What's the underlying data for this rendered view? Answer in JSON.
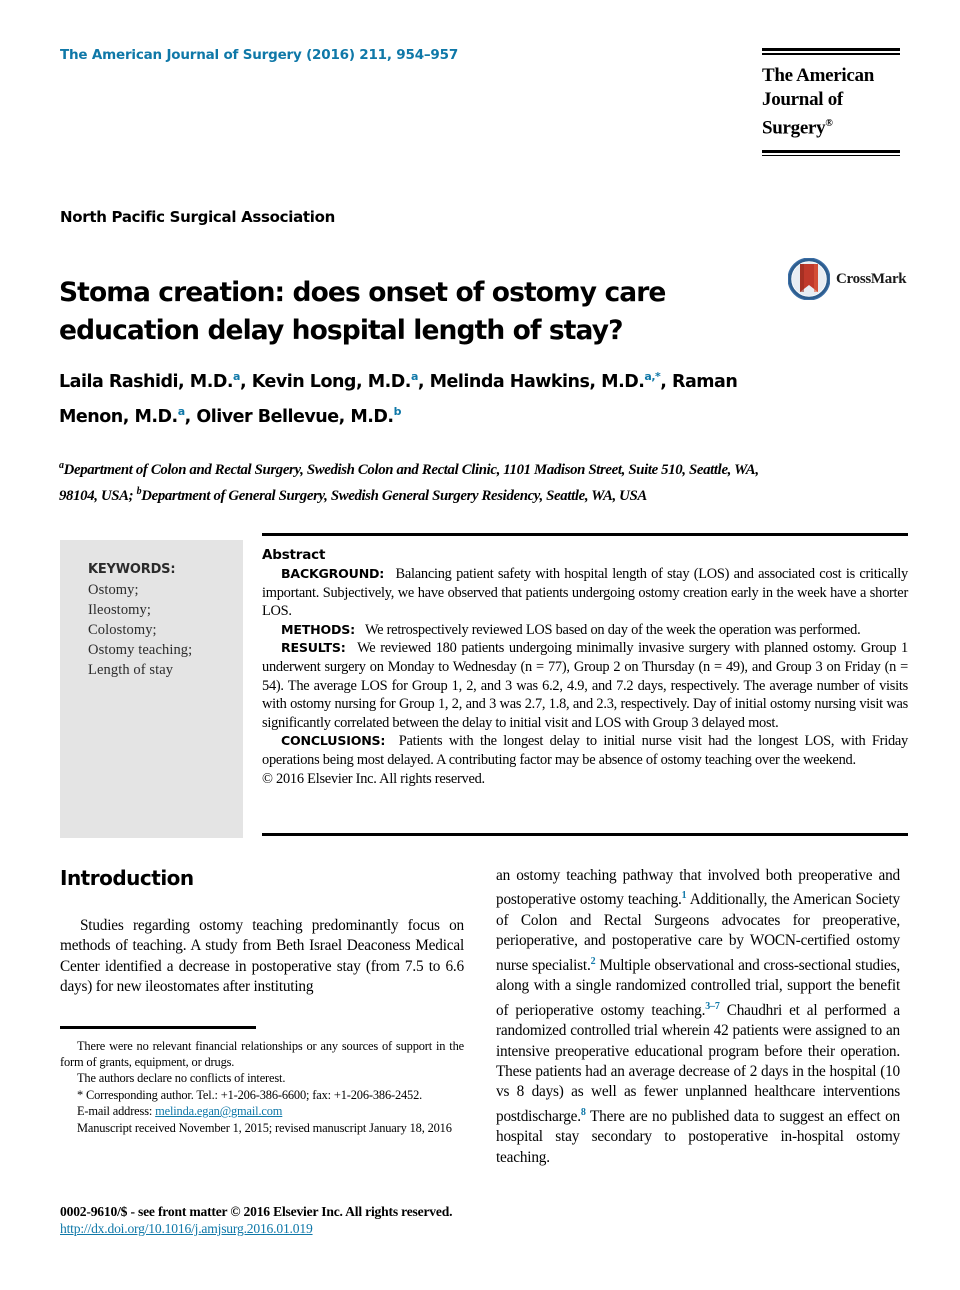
{
  "running_head": "The American Journal of Surgery (2016) 211, 954–957",
  "accent_color": "#0f78a8",
  "journal_logo": {
    "line1": "The American",
    "line2": "Journal of Surgery",
    "trademark": "®"
  },
  "society_line": "North Pacific Surgical Association",
  "article_title": "Stoma creation: does onset of ostomy care education delay hospital length of stay?",
  "crossmark": {
    "label": "CrossMark",
    "icon": "crossmark-badge-icon"
  },
  "authors": [
    {
      "name": "Laila Rashidi, M.D.",
      "marks": "a",
      "sep": ", "
    },
    {
      "name": "Kevin Long, M.D.",
      "marks": "a",
      "sep": ", "
    },
    {
      "name": "Melinda Hawkins, M.D.",
      "marks": "a,*",
      "sep": ", "
    },
    {
      "name": "Raman Menon, M.D.",
      "marks": "a",
      "sep": ", "
    },
    {
      "name": "Oliver Bellevue, M.D.",
      "marks": "b",
      "sep": ""
    }
  ],
  "affiliations": [
    {
      "mark": "a",
      "text": "Department of Colon and Rectal Surgery, Swedish Colon and Rectal Clinic, 1101 Madison Street, Suite 510, Seattle, WA, 98104, USA; "
    },
    {
      "mark": "b",
      "text": "Department of General Surgery, Swedish General Surgery Residency, Seattle, WA, USA"
    }
  ],
  "keywords": {
    "heading": "KEYWORDS:",
    "items": [
      "Ostomy;",
      "Ileostomy;",
      "Colostomy;",
      "Ostomy teaching;",
      "Length of stay"
    ]
  },
  "abstract": {
    "heading": "Abstract",
    "sections": [
      {
        "label": "BACKGROUND:",
        "text": "Balancing patient safety with hospital length of stay (LOS) and associated cost is critically important. Subjectively, we have observed that patients undergoing ostomy creation early in the week have a shorter LOS."
      },
      {
        "label": "METHODS:",
        "text": "We retrospectively reviewed LOS based on day of the week the operation was performed."
      },
      {
        "label": "RESULTS:",
        "text": "We reviewed 180 patients undergoing minimally invasive surgery with planned ostomy. Group 1 underwent surgery on Monday to Wednesday (n = 77), Group 2 on Thursday (n = 49), and Group 3 on Friday (n = 54). The average LOS for Group 1, 2, and 3 was 6.2, 4.9, and 7.2 days, respectively. The average number of visits with ostomy nursing for Group 1, 2, and 3 was 2.7, 1.8, and 2.3, respectively. Day of initial ostomy nursing visit was significantly correlated between the delay to initial visit and LOS with Group 3 delayed most."
      },
      {
        "label": "CONCLUSIONS:",
        "text": "Patients with the longest delay to initial nurse visit had the longest LOS, with Friday operations being most delayed. A contributing factor may be absence of ostomy teaching over the weekend."
      }
    ],
    "copyright": "© 2016 Elsevier Inc. All rights reserved."
  },
  "introduction": {
    "heading": "Introduction",
    "left_paragraph_part1": "Studies regarding ostomy teaching predominantly focus on methods of teaching. A study from Beth Israel Deaconess Medical Center identified a decrease in postoperative stay (from 7.5 to 6.6 days) for new ileostomates after instituting",
    "right_segments": [
      {
        "text": "an ostomy teaching pathway that involved both preoperative and postoperative ostomy teaching.",
        "ref": "1"
      },
      {
        "text": " Additionally, the American Society of Colon and Rectal Surgeons advocates for preoperative, perioperative, and postoperative care by WOCN-certified ostomy nurse specialist.",
        "ref": "2"
      },
      {
        "text": " Multiple observational and cross-sectional studies, along with a single randomized controlled trial, support the benefit of perioperative ostomy teaching.",
        "ref": "3–7"
      },
      {
        "text": " Chaudhri et al performed a randomized controlled trial wherein 42 patients were assigned to an intensive preoperative educational program before their operation. These patients had an average decrease of 2 days in the hospital (10 vs 8 days) as well as fewer unplanned healthcare interventions postdischarge.",
        "ref": "8"
      },
      {
        "text": " There are no published data to suggest an effect on hospital stay secondary to postoperative in-hospital ostomy teaching.",
        "ref": ""
      }
    ]
  },
  "footnotes": {
    "funding": "There were no relevant financial relationships or any sources of support in the form of grants, equipment, or drugs.",
    "conflicts": "The authors declare no conflicts of interest.",
    "corresponding": "* Corresponding author. Tel.: +1-206-386-6600; fax: +1-206-386-2452.",
    "email_label": "E-mail address:",
    "email_address": "melinda.egan@gmail.com",
    "manuscript": "Manuscript received November 1, 2015; revised manuscript January 18, 2016"
  },
  "page_footer": {
    "issn_line": "0002-9610/$ - see front matter © 2016 Elsevier Inc. All rights reserved.",
    "doi": "http://dx.doi.org/10.1016/j.amjsurg.2016.01.019"
  }
}
